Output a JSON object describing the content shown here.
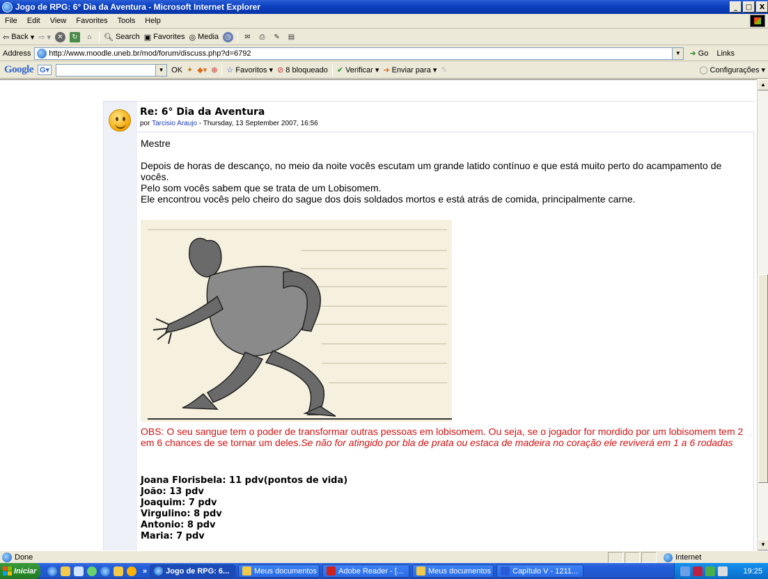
{
  "window": {
    "title": "Jogo de RPG: 6° Dia da Aventura - Microsoft Internet Explorer",
    "buttons": [
      "_",
      "□",
      "X"
    ]
  },
  "menu": [
    "File",
    "Edit",
    "View",
    "Favorites",
    "Tools",
    "Help"
  ],
  "toolbar": {
    "back": "Back",
    "search": "Search",
    "favorites": "Favorites",
    "media": "Media"
  },
  "address": {
    "label": "Address",
    "url": "http://www.moodle.uneb.br/mod/forum/discuss.php?d=6792",
    "go": "Go",
    "links": "Links"
  },
  "google_toolbar": {
    "logo": "Google",
    "ok": "OK",
    "favoritos": "Favoritos",
    "bloqueado": "8 bloqueado",
    "verificar": "Verificar",
    "enviar": "Enviar para",
    "configuracoes": "Configurações"
  },
  "post": {
    "subject": "Re: 6° Dia da Aventura",
    "author_prefix": "por",
    "author": "Tarcisio Araujo",
    "date": "- Thursday, 13 September 2007, 16:56",
    "paragraphs": [
      "Mestre",
      "Depois de horas de descanço, no meio da noite vocês escutam um grande latido contínuo e que está muito perto do acampamento de vocês.",
      "Pelo som vocês sabem que se trata de um Lobisomem.",
      "Ele encontrou vocês pelo cheiro do sague dos dois soldados mortos e está atrás de comida, principalmente carne."
    ],
    "obs_normal": "OBS: O seu sangue tem o poder de transformar outras pessoas em lobisomem. Ou seja, se o jogador for mordido por um lobisomem tem 2 em 6 chances de se tornar um deles.",
    "obs_italic": "Se não for atingido por bla de prata ou estaca de madeira no coração ele reviverá em 1 a 6 rodadas",
    "stats": [
      "Joana Florisbela: 11 pdv(pontos de vida)",
      "João: 13 pdv",
      "Joaquim: 7 pdv",
      "Virgulino: 8 pdv",
      "Antonio: 8 pdv",
      "Maria: 7 pdv"
    ]
  },
  "status": {
    "text": "Done",
    "zone": "Internet"
  },
  "taskbar": {
    "start": "Iniciar",
    "more": "»",
    "tasks": [
      "Jogo de RPG: 6...",
      "Meus documentos",
      "Adobe Reader - [...",
      "Meus documentos",
      "Capítulo V - 1211..."
    ],
    "clock": "19:25"
  },
  "colors": {
    "obs_red": "#d21010",
    "link_blue": "#1a3cb0",
    "xp_blue": "#0a3fbf"
  }
}
